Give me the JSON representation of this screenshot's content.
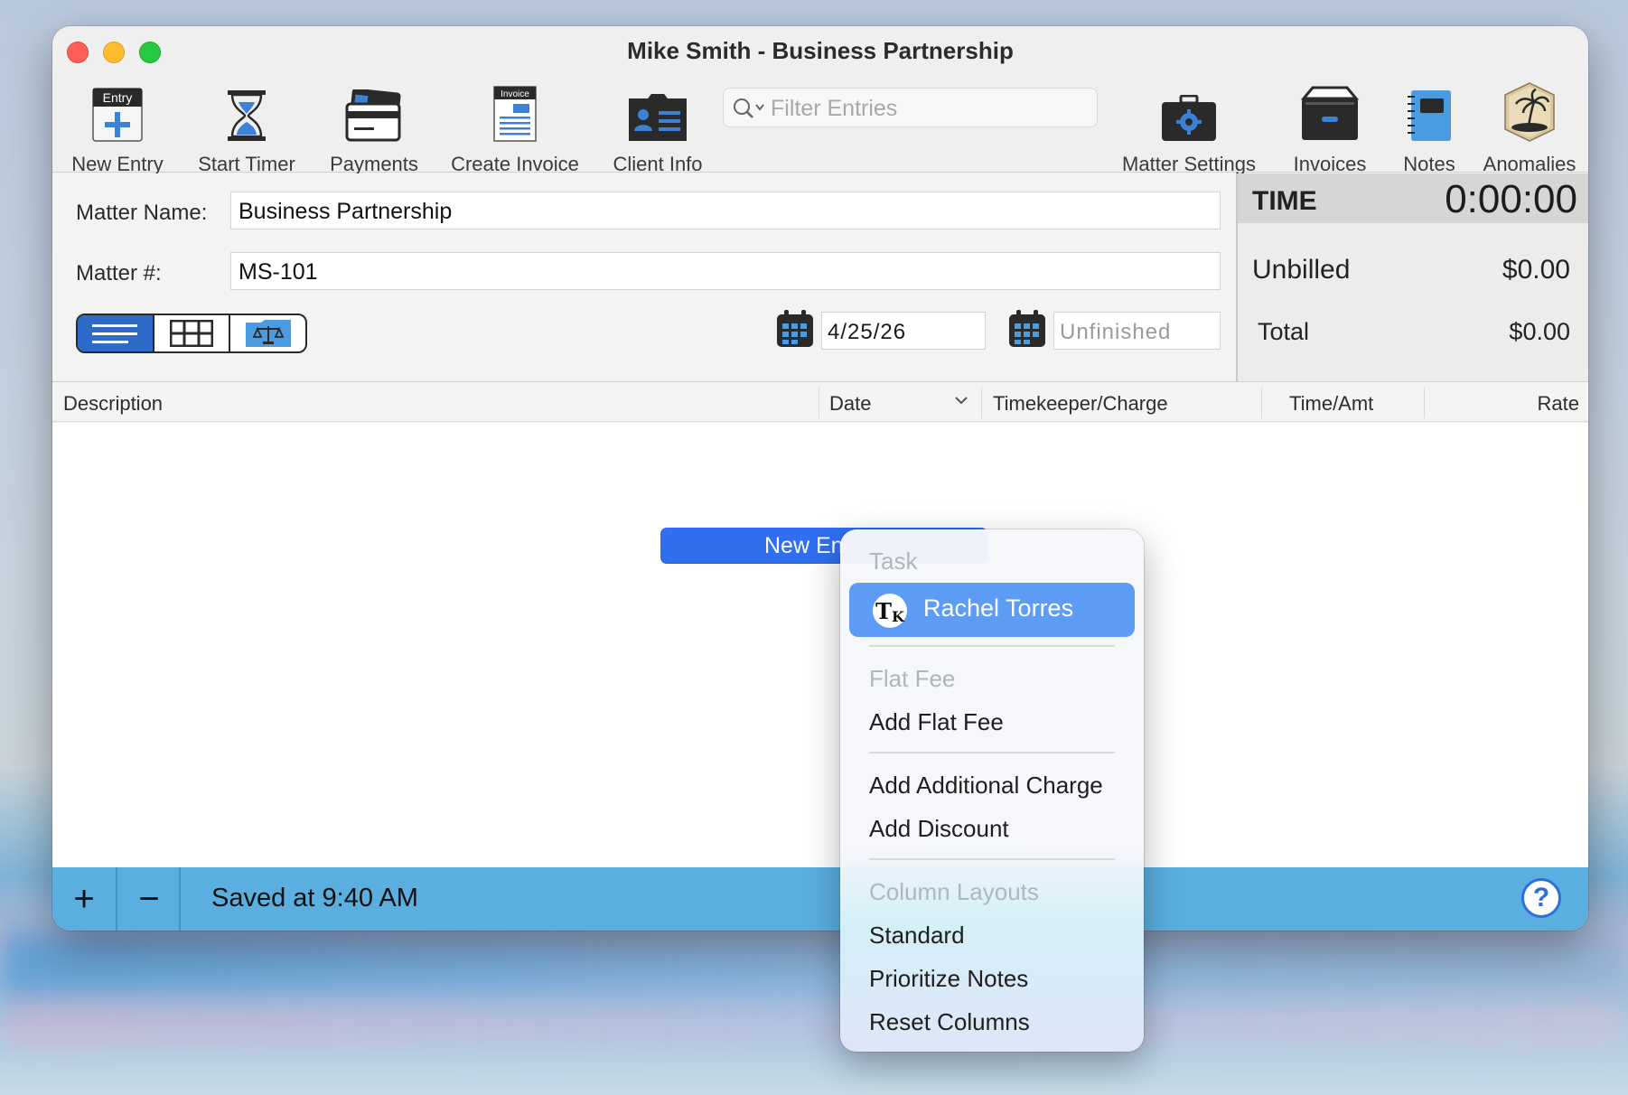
{
  "window": {
    "title": "Mike Smith - Business Partnership"
  },
  "toolbar": {
    "new_entry": "New Entry",
    "new_entry_badge": "Entry",
    "start_timer": "Start Timer",
    "payments": "Payments",
    "create_invoice": "Create Invoice",
    "invoice_badge": "Invoice",
    "client_info": "Client Info",
    "filter_placeholder": "Filter Entries",
    "matter_settings": "Matter Settings",
    "invoices": "Invoices",
    "notes": "Notes",
    "anomalies": "Anomalies"
  },
  "form": {
    "matter_name_label": "Matter Name:",
    "matter_name_value": "Business Partnership",
    "matter_number_label": "Matter #:",
    "matter_number_value": "MS-101",
    "start_date": "4/25/26",
    "end_date_placeholder": "Unfinished"
  },
  "summary": {
    "time_label": "TIME",
    "time_value": "0:00:00",
    "unbilled_label": "Unbilled",
    "unbilled_value": "$0.00",
    "total_label": "Total",
    "total_value": "$0.00"
  },
  "table": {
    "columns": [
      "Description",
      "Date",
      "Timekeeper/Charge",
      "Time/Amt",
      "Rate"
    ]
  },
  "body": {
    "new_entry_button": "New En"
  },
  "statusbar": {
    "add": "+",
    "remove": "−",
    "saved_text": "Saved at 9:40 AM",
    "help": "?"
  },
  "menu": {
    "task_header": "Task",
    "timekeeper_initials": "T",
    "timekeeper_initials_sub": "K",
    "timekeeper_name": "Rachel Torres",
    "flat_fee_header": "Flat Fee",
    "add_flat_fee": "Add Flat Fee",
    "add_additional_charge": "Add Additional Charge",
    "add_discount": "Add Discount",
    "column_layouts_header": "Column Layouts",
    "standard": "Standard",
    "prioritize_notes": "Prioritize Notes",
    "reset_columns": "Reset Columns"
  },
  "colors": {
    "accent_blue": "#2f6ff0",
    "status_bar": "#5aafe0",
    "menu_selected": "#5d9cf4"
  }
}
